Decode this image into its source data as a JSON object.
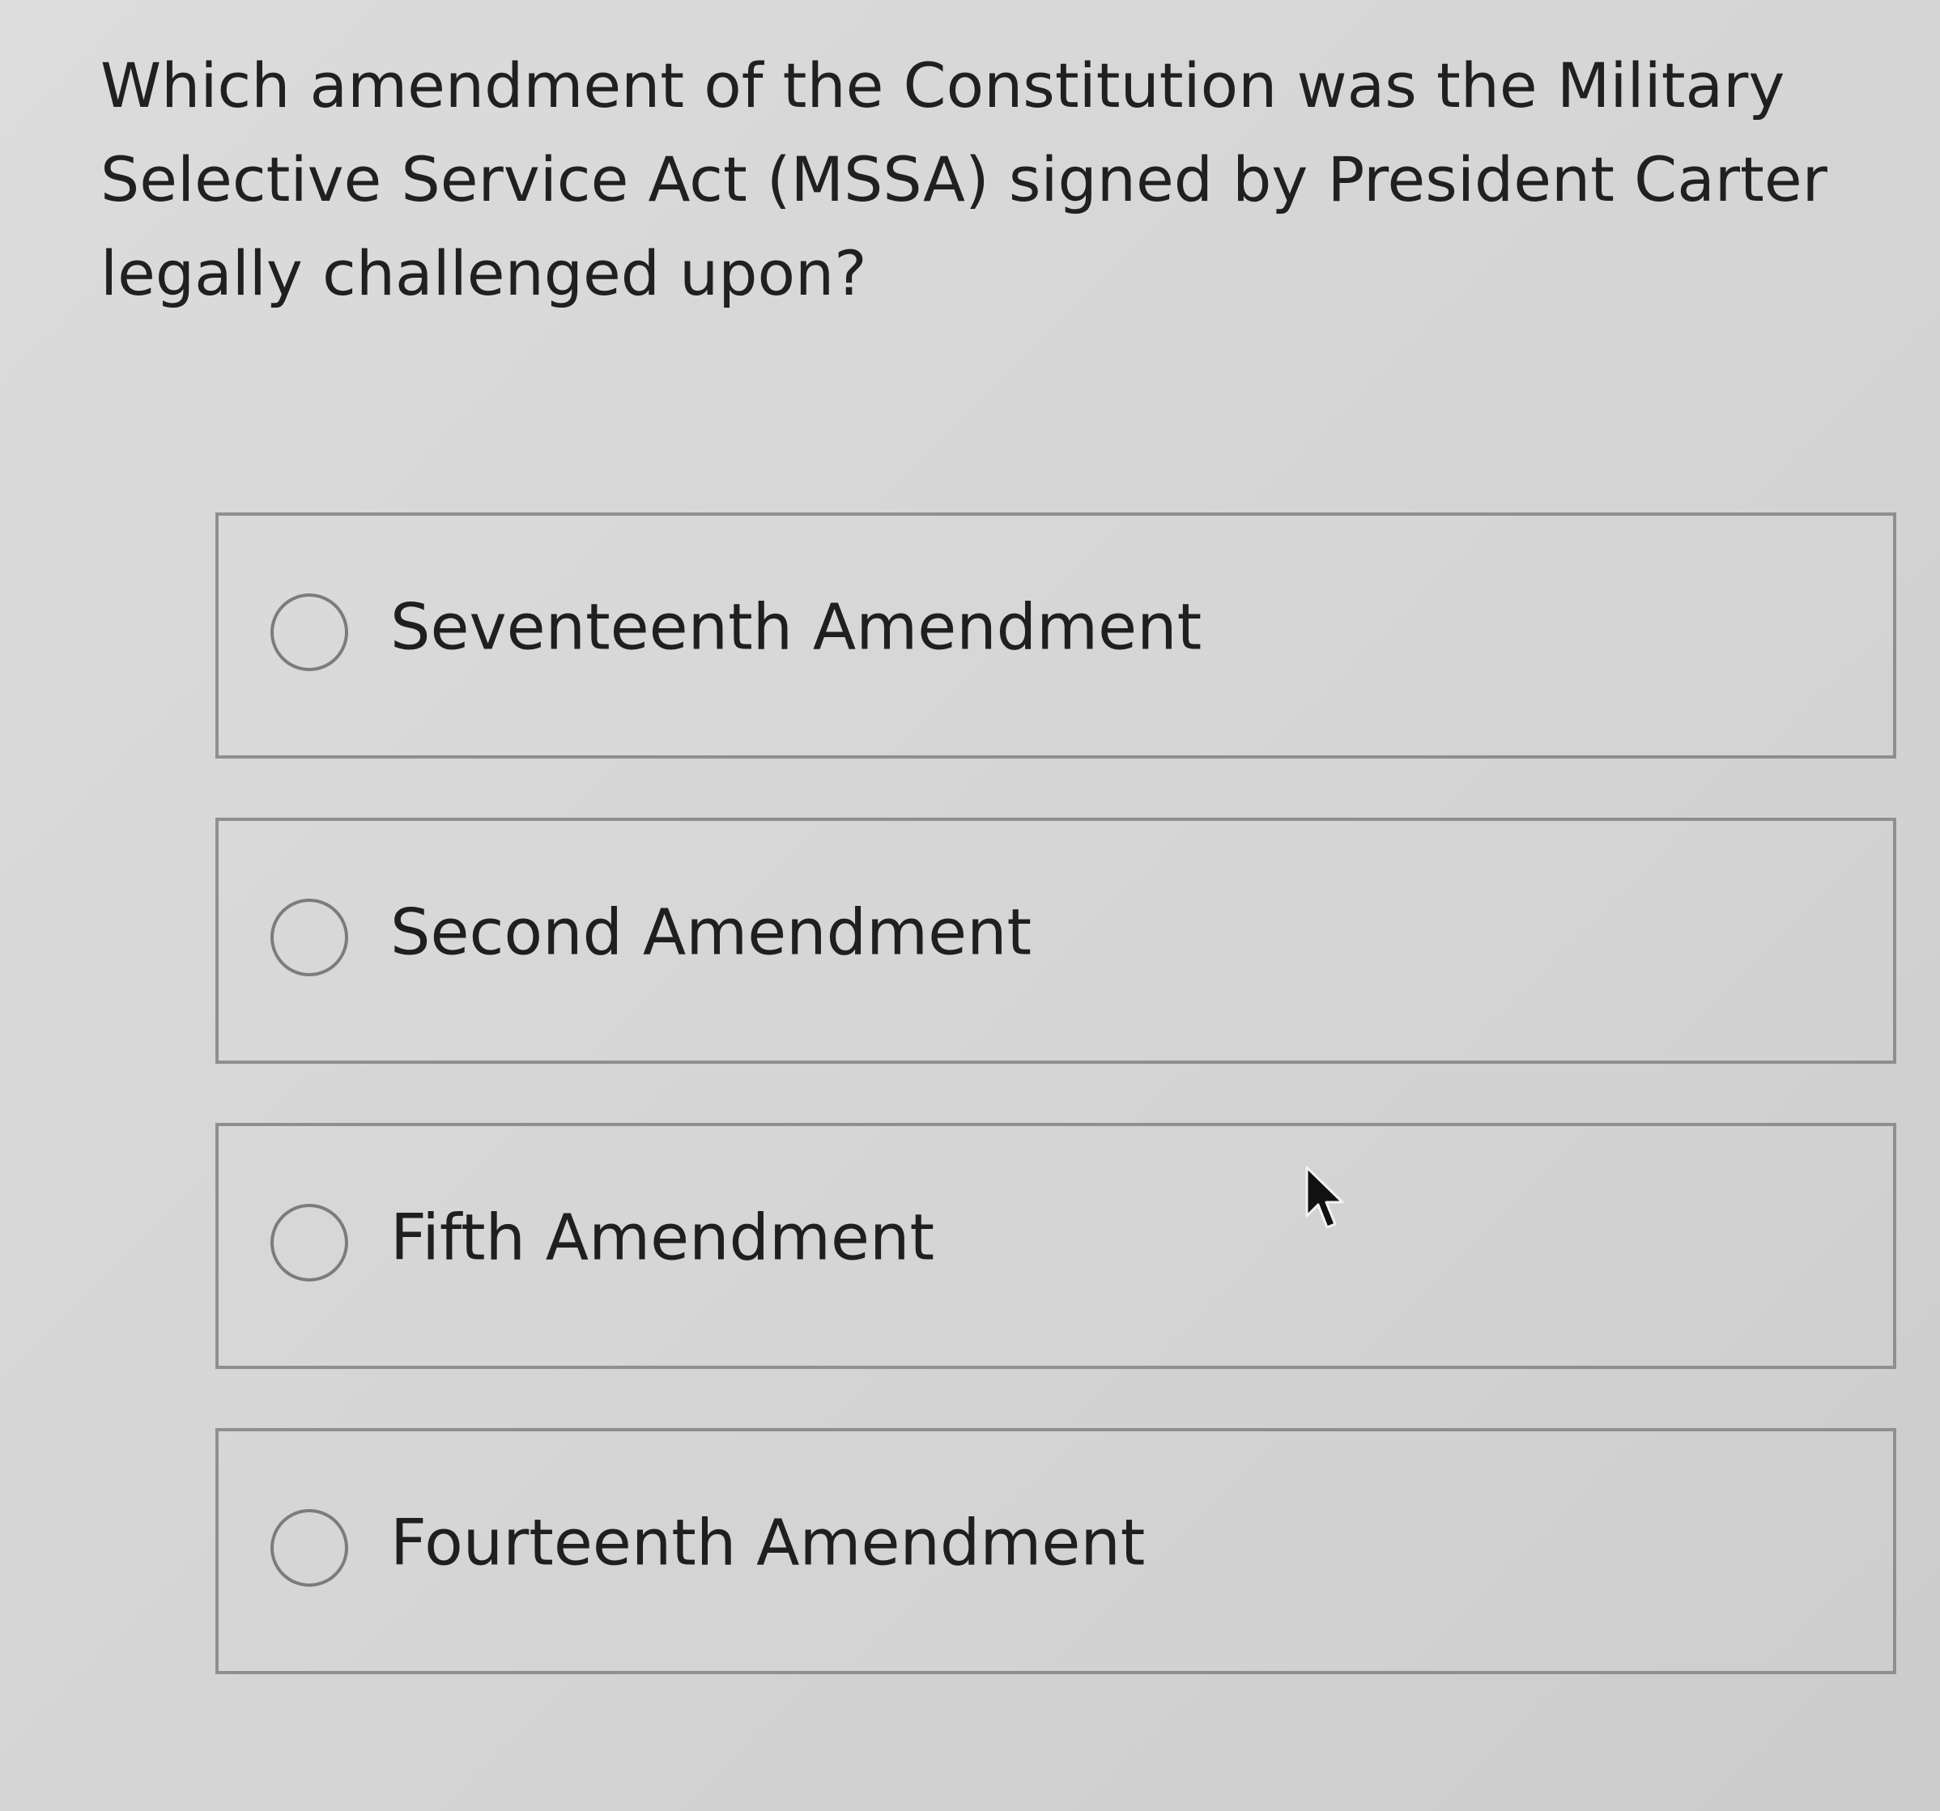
{
  "question": {
    "text": "Which amendment of the Constitution was the Military Selective Service Act (MSSA) signed by President Carter legally challenged upon?"
  },
  "options": [
    {
      "label": "Seventeenth Amendment",
      "selected": false
    },
    {
      "label": "Second Amendment",
      "selected": false
    },
    {
      "label": "Fifth Amendment",
      "selected": false
    },
    {
      "label": "Fourteenth Amendment",
      "selected": false
    }
  ],
  "icons": {
    "radio": "radio-button-icon",
    "cursor": "mouse-pointer-icon"
  },
  "colors": {
    "background": "#d6d6d6",
    "text": "#202020",
    "border": "#8f8f8f"
  }
}
